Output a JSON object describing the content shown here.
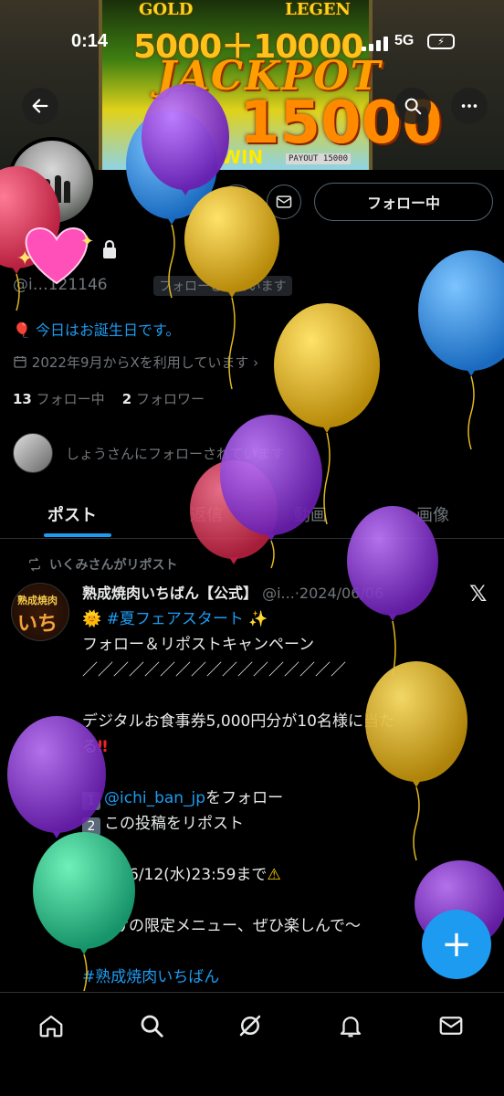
{
  "banner": {
    "gold": "GOLD",
    "legend": "LEGEN",
    "jackpot_numbers": "5000＋10000",
    "jackpot": "JACKPOT",
    "big_number": "15000",
    "win": "WIN",
    "payout": "PAYOUT 15000"
  },
  "status_bar": {
    "time": "0:14",
    "network": "5G"
  },
  "profile": {
    "handle": "@i…121146",
    "follows_you": "フォローされています",
    "birthday": "今日はお誕生日です。",
    "joined": "2022年9月からXを利用しています",
    "following_count": "13",
    "following_label": "フォロー中",
    "followers_count": "2",
    "followers_label": "フォロワー",
    "mutual": "しょうさんにフォローされています",
    "follow_button": "フォロー中"
  },
  "tabs": [
    {
      "label": "ポスト",
      "active": true
    },
    {
      "label": "返信",
      "active": false
    },
    {
      "label": "動画",
      "active": false
    },
    {
      "label": "画像",
      "active": false
    }
  ],
  "post": {
    "repost_label": "いくみさんがリポスト",
    "avatar_text_top": "熟成焼肉",
    "avatar_text_bottom": "いちばん",
    "author_name": "熟成焼肉いちばん【公式】",
    "author_handle": "@i...",
    "date": "2024/06/06",
    "line1_hashtag": "#夏フェアスタート",
    "line2": "フォロー＆リポストキャンペーン",
    "line3": "／／／／／／／／／／／／／／／／／",
    "line4": "デジタルお食事券5,000円分が10名様に当た",
    "line5": "る",
    "step1_num": "1",
    "step1_mention": "@ichi_ban_jp",
    "step1_text": "をフォロー",
    "step2_num": "2",
    "step2_text": "この投稿をリポスト",
    "deadline": "応募は6/12(水)23:59まで",
    "closing": "今だけの限定メニュー、ぜひ楽しんで〜",
    "hashtag_footer": "#熟成焼肉いちばん"
  },
  "colors": {
    "accent": "#1d9bf0",
    "background": "#000000",
    "text_primary": "#e7e9ea",
    "text_secondary": "#71767b",
    "balloon_purple": "#8e35d6",
    "balloon_gold": "#e0b81c",
    "balloon_blue": "#2f8fe0",
    "balloon_red": "#e0405e",
    "balloon_green": "#2ec98a"
  },
  "icons": {
    "header": [
      "back-arrow-icon",
      "search-icon",
      "more-icon"
    ],
    "actions": [
      "notifications-icon",
      "message-icon"
    ],
    "nav": [
      "home-icon",
      "search-icon",
      "grok-icon",
      "notifications-icon",
      "messages-icon"
    ]
  }
}
